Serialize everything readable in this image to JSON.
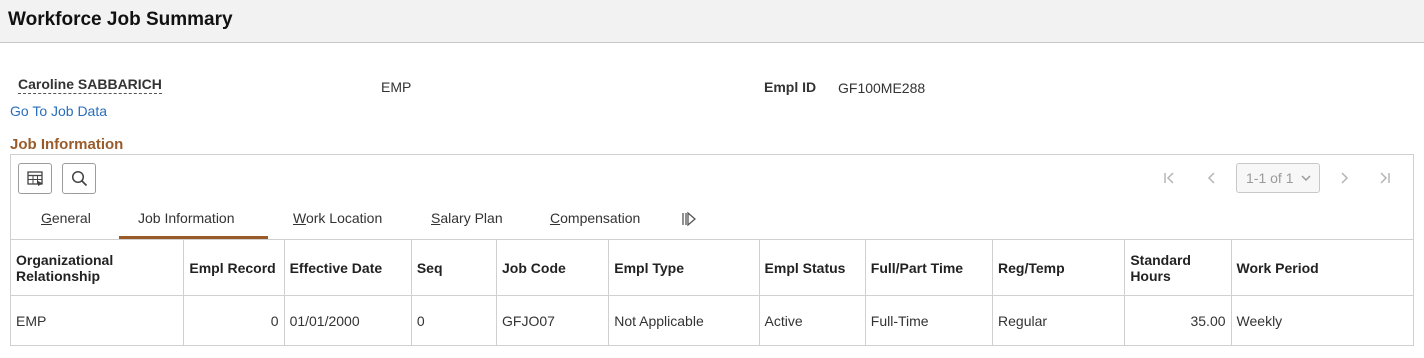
{
  "header": {
    "title": "Workforce Job Summary"
  },
  "employee": {
    "name": "Caroline SABBARICH",
    "org_relationship": "EMP",
    "emplid_label": "Empl ID",
    "emplid_value": "GF100ME288",
    "goto_link": "Go To Job Data"
  },
  "section": {
    "title": "Job Information"
  },
  "toolbar": {
    "personalize_icon": "grid-settings-icon",
    "find_icon": "search-icon"
  },
  "pager": {
    "range": "1-1 of 1",
    "first_icon": "first-page-icon",
    "prev_icon": "previous-page-icon",
    "next_icon": "next-page-icon",
    "last_icon": "last-page-icon"
  },
  "tabs": [
    {
      "accel": "G",
      "rest": "eneral"
    },
    {
      "accel": "",
      "rest": "Job Information"
    },
    {
      "accel": "W",
      "rest": "ork Location"
    },
    {
      "accel": "S",
      "rest": "alary Plan"
    },
    {
      "accel": "C",
      "rest": "ompensation"
    }
  ],
  "active_tab": "Job Information",
  "table": {
    "columns": [
      "Organizational Relationship",
      "Empl Record",
      "Effective Date",
      "Seq",
      "Job Code",
      "Empl Type",
      "Empl Status",
      "Full/Part Time",
      "Reg/Temp",
      "Standard Hours",
      "Work Period"
    ],
    "rows": [
      [
        "EMP",
        "0",
        "01/01/2000",
        "0",
        "GFJO07",
        "Not Applicable",
        "Active",
        "Full-Time",
        "Regular",
        "35.00",
        "Weekly"
      ]
    ]
  },
  "colors": {
    "accent": "#9a5b2b",
    "link": "#2a6ebb",
    "header_bg": "#f2f2f2"
  }
}
